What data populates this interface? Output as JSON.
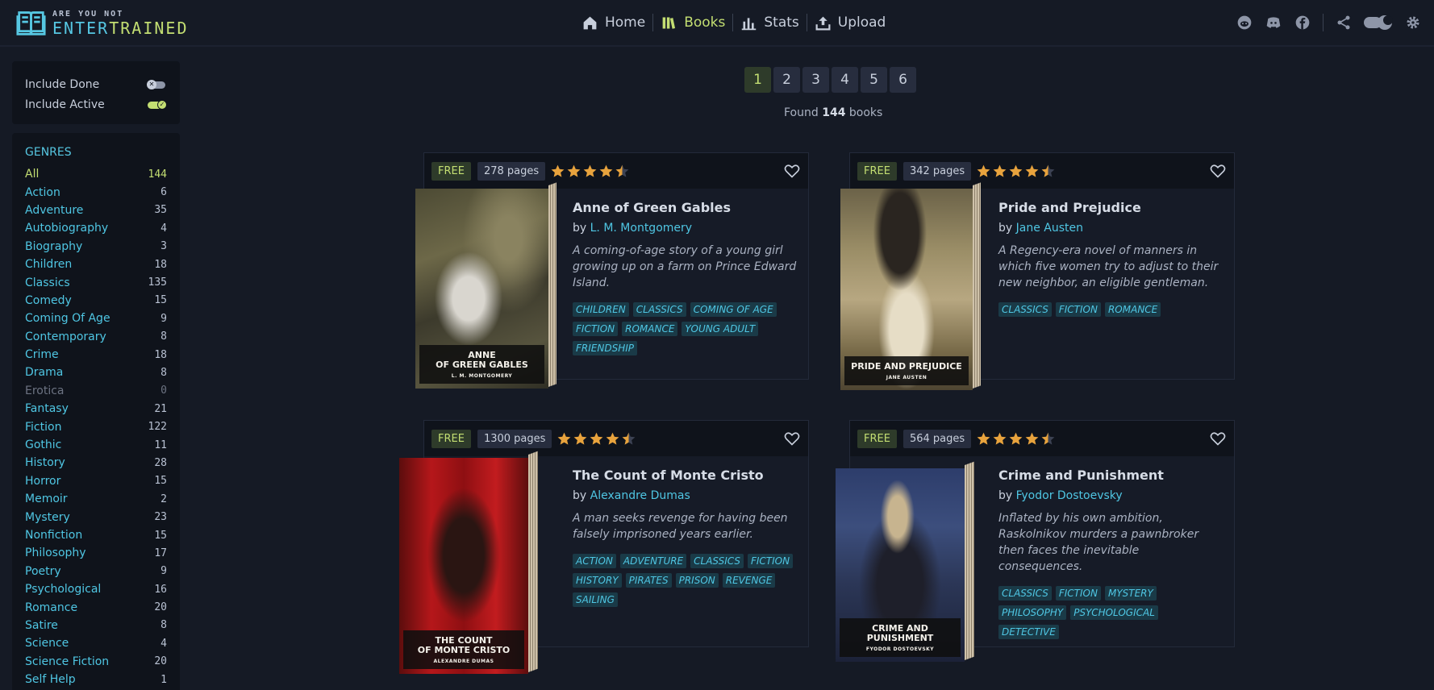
{
  "logo": {
    "small": "ARE YOU NOT",
    "big_a": "ENTER",
    "big_b": "TRAINED"
  },
  "nav": [
    {
      "label": "Home",
      "icon": "home-icon"
    },
    {
      "label": "Books",
      "icon": "books-icon",
      "active": true
    },
    {
      "label": "Stats",
      "icon": "stats-icon"
    },
    {
      "label": "Upload",
      "icon": "upload-icon"
    }
  ],
  "header_icons": [
    "reddit-icon",
    "discord-icon",
    "facebook-icon",
    "share-icon",
    "theme-toggle-icon",
    "gear-icon"
  ],
  "filters": {
    "include_done": {
      "label": "Include Done",
      "on": false
    },
    "include_active": {
      "label": "Include Active",
      "on": true
    }
  },
  "genres": {
    "title": "GENRES",
    "items": [
      {
        "name": "All",
        "count": "144",
        "active": true
      },
      {
        "name": "Action",
        "count": "6"
      },
      {
        "name": "Adventure",
        "count": "35"
      },
      {
        "name": "Autobiography",
        "count": "4"
      },
      {
        "name": "Biography",
        "count": "3"
      },
      {
        "name": "Children",
        "count": "18"
      },
      {
        "name": "Classics",
        "count": "135"
      },
      {
        "name": "Comedy",
        "count": "15"
      },
      {
        "name": "Coming Of Age",
        "count": "9"
      },
      {
        "name": "Contemporary",
        "count": "8"
      },
      {
        "name": "Crime",
        "count": "18"
      },
      {
        "name": "Drama",
        "count": "8"
      },
      {
        "name": "Erotica",
        "count": "0",
        "disabled": true
      },
      {
        "name": "Fantasy",
        "count": "21"
      },
      {
        "name": "Fiction",
        "count": "122"
      },
      {
        "name": "Gothic",
        "count": "11"
      },
      {
        "name": "History",
        "count": "28"
      },
      {
        "name": "Horror",
        "count": "15"
      },
      {
        "name": "Memoir",
        "count": "2"
      },
      {
        "name": "Mystery",
        "count": "23"
      },
      {
        "name": "Nonfiction",
        "count": "15"
      },
      {
        "name": "Philosophy",
        "count": "17"
      },
      {
        "name": "Poetry",
        "count": "9"
      },
      {
        "name": "Psychological",
        "count": "16"
      },
      {
        "name": "Romance",
        "count": "20"
      },
      {
        "name": "Satire",
        "count": "8"
      },
      {
        "name": "Science",
        "count": "4"
      },
      {
        "name": "Science Fiction",
        "count": "20"
      },
      {
        "name": "Self Help",
        "count": "1"
      }
    ]
  },
  "pagination": {
    "pages": [
      "1",
      "2",
      "3",
      "4",
      "5",
      "6"
    ],
    "current": "1"
  },
  "found": {
    "prefix": "Found",
    "count": "144",
    "suffix": "books"
  },
  "colors": {
    "accent_green": "#c3de72",
    "accent_cyan": "#4fc6e3",
    "star": "#e8a33d"
  },
  "books": [
    {
      "free": "FREE",
      "pages": "278 pages",
      "rating": 4.5,
      "title": "Anne of Green Gables",
      "by": "by",
      "author": "L. M. Montgomery",
      "description": "A coming-of-age story of a young girl growing up on a farm on Prince Edward Island.",
      "tags": [
        "CHILDREN",
        "CLASSICS",
        "COMING OF AGE",
        "FICTION",
        "ROMANCE",
        "YOUNG ADULT",
        "FRIENDSHIP"
      ],
      "cover_title": "ANNE\nOF GREEN GABLES",
      "cover_author": "L. M. MONTGOMERY"
    },
    {
      "free": "FREE",
      "pages": "342 pages",
      "rating": 4.5,
      "title": "Pride and Prejudice",
      "by": "by",
      "author": "Jane Austen",
      "description": "A Regency-era novel of manners in which five women try to adjust to their new neighbor, an eligible gentleman.",
      "tags": [
        "CLASSICS",
        "FICTION",
        "ROMANCE"
      ],
      "cover_title": "PRIDE AND PREJUDICE",
      "cover_author": "JANE AUSTEN"
    },
    {
      "free": "FREE",
      "pages": "1300 pages",
      "rating": 4.5,
      "title": "The Count of Monte Cristo",
      "by": "by",
      "author": "Alexandre Dumas",
      "description": "A man seeks revenge for having been falsely imprisoned years earlier.",
      "tags": [
        "ACTION",
        "ADVENTURE",
        "CLASSICS",
        "FICTION",
        "HISTORY",
        "PIRATES",
        "PRISON",
        "REVENGE",
        "SAILING"
      ],
      "cover_title": "THE COUNT\nOF MONTE CRISTO",
      "cover_author": "ALEXANDRE DUMAS"
    },
    {
      "free": "FREE",
      "pages": "564 pages",
      "rating": 4.5,
      "title": "Crime and Punishment",
      "by": "by",
      "author": "Fyodor Dostoevsky",
      "description": "Inflated by his own ambition, Raskolnikov murders a pawnbroker then faces the inevitable consequences.",
      "tags": [
        "CLASSICS",
        "FICTION",
        "MYSTERY",
        "PHILOSOPHY",
        "PSYCHOLOGICAL",
        "DETECTIVE"
      ],
      "cover_title": "CRIME AND\nPUNISHMENT",
      "cover_author": "FYODOR DOSTOEVSKY"
    }
  ]
}
